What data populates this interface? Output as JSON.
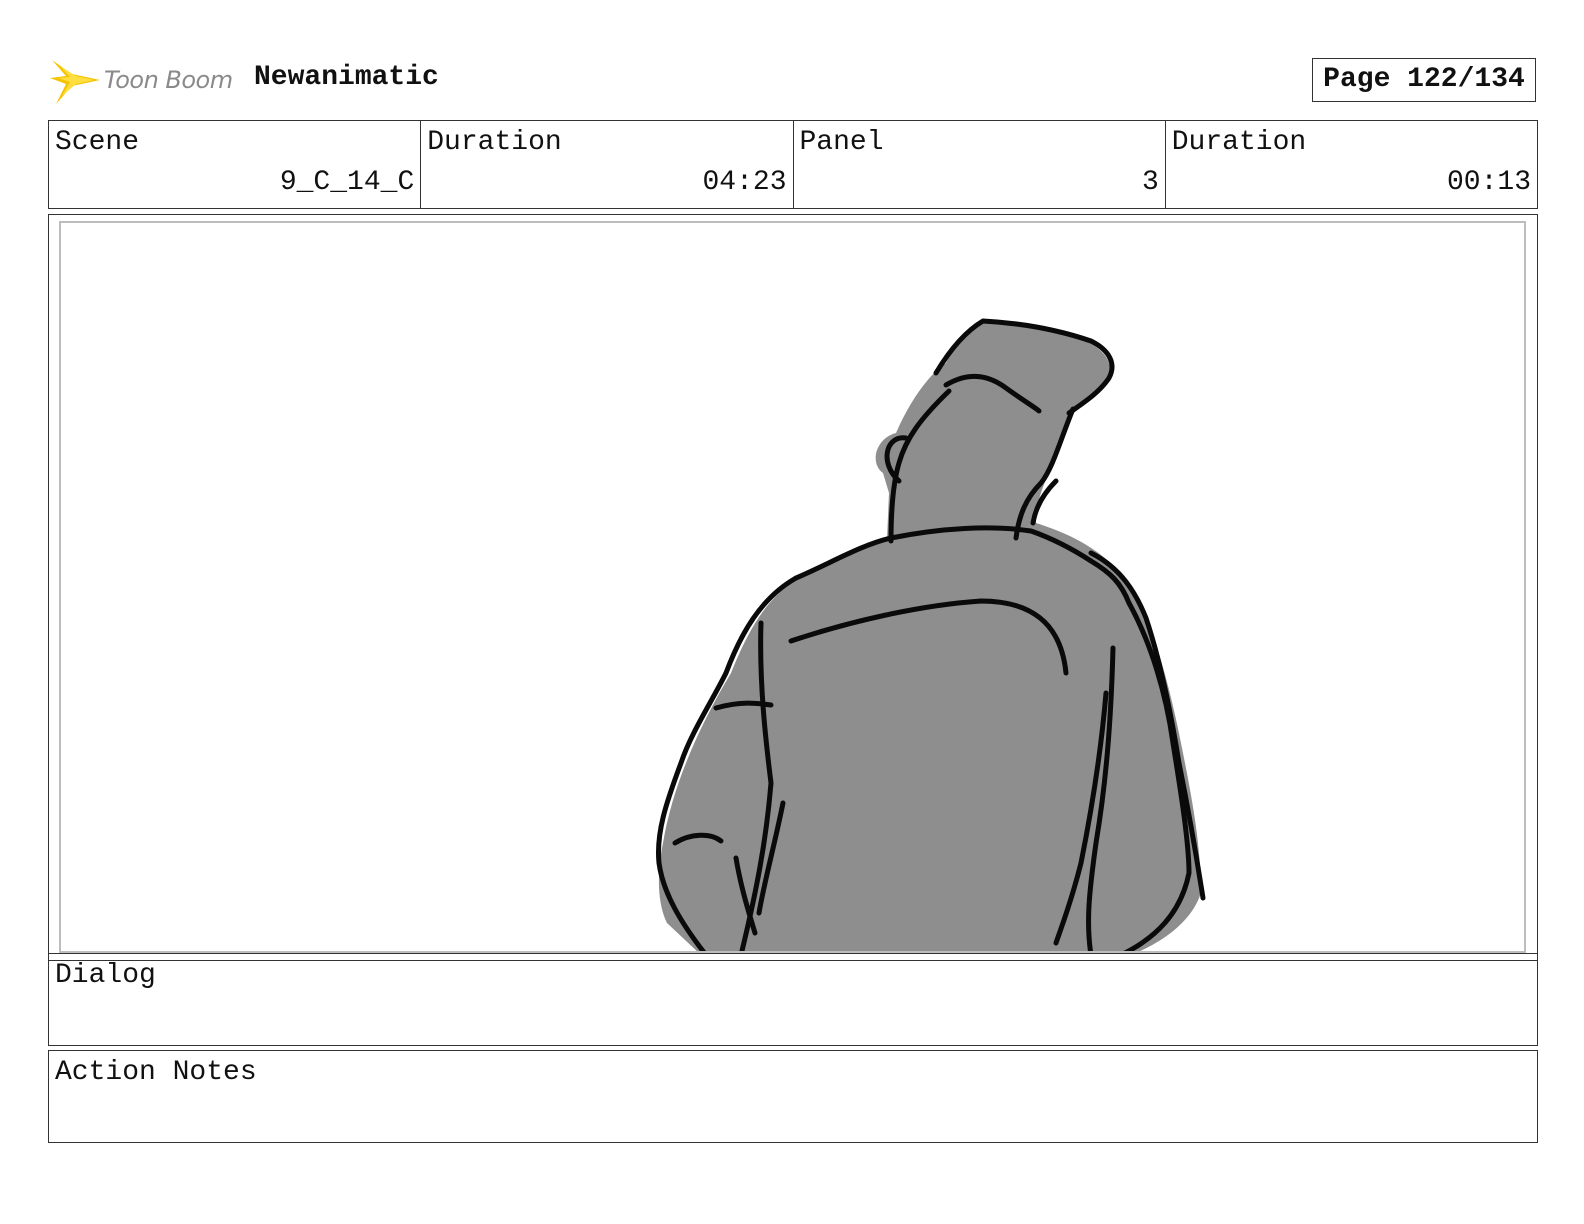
{
  "header": {
    "logo_text": "Toon Boom",
    "project_title": "Newanimatic",
    "page_label": "Page 122/134"
  },
  "info": {
    "scene_label": "Scene",
    "scene_value": "9_C_14_C",
    "scene_duration_label": "Duration",
    "scene_duration_value": "04:23",
    "panel_label": "Panel",
    "panel_value": "3",
    "panel_duration_label": "Duration",
    "panel_duration_value": "00:13"
  },
  "dialog": {
    "label": "Dialog",
    "text": ""
  },
  "action_notes": {
    "label": "Action Notes",
    "text": ""
  },
  "colors": {
    "sketch_fill": "#8e8e8e",
    "sketch_line": "#0a0a0a",
    "border": "#333333"
  }
}
